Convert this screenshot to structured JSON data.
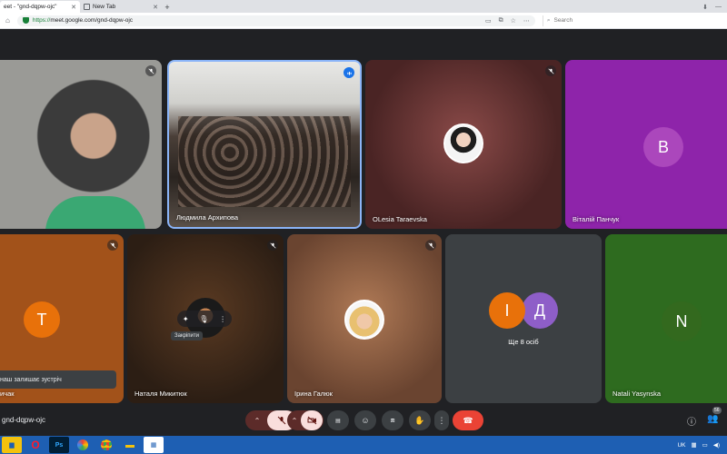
{
  "browser": {
    "tabs": [
      {
        "title": "eet - \"gnd-dqpw-ojc\"",
        "active": true
      },
      {
        "title": "New Tab",
        "active": false
      }
    ],
    "url_scheme": "https://",
    "url_rest": "meet.google.com/gnd-dqpw-ojc",
    "search_placeholder": "Search"
  },
  "meet": {
    "tiles": [
      {
        "name": "",
        "kind": "video"
      },
      {
        "name": "Людмила Архипова",
        "kind": "video-active"
      },
      {
        "name": "OLesia Taraevska",
        "kind": "photo"
      },
      {
        "name": "Віталій Панчук",
        "kind": "letter",
        "letter": "В",
        "bg": "#8e24aa",
        "avatar": "#ab47bc"
      },
      {
        "name": "ичак",
        "kind": "letter",
        "letter": "Т",
        "bg": "#a2521a",
        "avatar": "#e8710a"
      },
      {
        "name": "Наталя Микитюк",
        "kind": "photo-dark"
      },
      {
        "name": "Ірина Галюк",
        "kind": "photo"
      },
      {
        "name": "Ще 8 осіб",
        "kind": "group",
        "letters": [
          "І",
          "Д"
        ]
      },
      {
        "name": "Natali Yasynska",
        "kind": "letter",
        "letter": "N",
        "bg": "#2e6b1f",
        "avatar": "#33691e"
      }
    ],
    "toast_text": "наш залишає зустріч",
    "tooltip_text": "Закріпити",
    "meeting_code": "gnd-dqpw-ojc",
    "participants_count": "56"
  },
  "taskbar": {
    "lang": "UK"
  }
}
